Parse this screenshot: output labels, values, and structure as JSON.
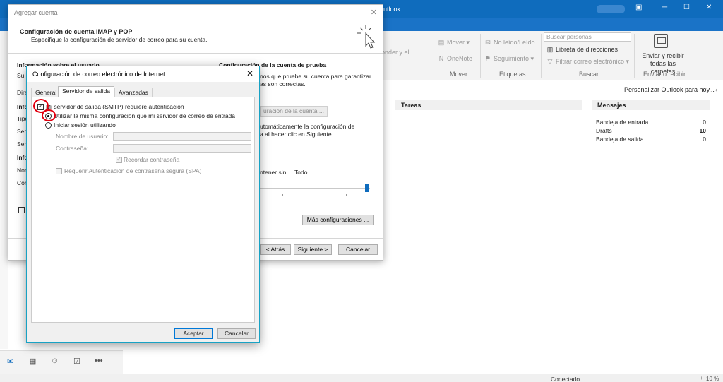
{
  "outlook": {
    "app_title": "utlook",
    "ribbon": {
      "mover": "Mover",
      "onenote": "OneNote",
      "group_mover": "Mover",
      "no_leido": "No leído/Leído",
      "seguimiento": "Seguimiento",
      "group_etiquetas": "Etiquetas",
      "search_placeholder": "Buscar personas",
      "libreta": "Libreta de direcciones",
      "filtrar": "Filtrar correo electrónico",
      "group_buscar": "Buscar",
      "enviar_recibir": "Enviar y recibir todas las carpetas",
      "group_enviar": "Enviar o recibir",
      "partial_text": "onder y eli..."
    },
    "personalize": "Personalizar Outlook para hoy...",
    "tareas_header": "Tareas",
    "mensajes_header": "Mensajes",
    "mensajes": [
      {
        "name": "Bandeja de entrada",
        "count": "0"
      },
      {
        "name": "Drafts",
        "count": "10"
      },
      {
        "name": "Bandeja de salida",
        "count": "0"
      }
    ],
    "status": "Conectado",
    "zoom": "10 %",
    "nav_icons": [
      "mail-icon",
      "calendar-icon",
      "people-icon",
      "tasks-icon",
      "more-icon"
    ]
  },
  "agregar_cuenta": {
    "window_title": "Agregar cuenta",
    "heading": "Configuración de cuenta IMAP y POP",
    "subheading": "Especifique la configuración de servidor de correo para su cuenta.",
    "user_info_header": "Información sobre el usuario",
    "left_partial": [
      "Su",
      "Dire",
      "Info",
      "Tipo",
      "Ser",
      "Ser",
      "Info",
      "Nor",
      "Con"
    ],
    "test_header": "Configuración de la cuenta de prueba",
    "test_text_1": "nos que pruebe su cuenta para garantizar",
    "test_text_2": "as son correctas.",
    "test_button": "uración de la cuenta ...",
    "auto_text_1": "utomáticamente la configuración de",
    "auto_text_2": "a al hacer clic en Siguiente",
    "mantener": "ntener sin",
    "todo": "Todo",
    "mas_config": "Más configuraciones ...",
    "atras": "< Atrás",
    "siguiente": "Siguiente >",
    "cancelar": "Cancelar"
  },
  "internet_dialog": {
    "title": "Configuración de correo electrónico de Internet",
    "tabs": [
      "General",
      "Servidor de salida",
      "Avanzadas"
    ],
    "smtp_auth": "Mi servidor de salida (SMTP) requiere autenticación",
    "smtp_auth_checked": true,
    "use_same": "Utilizar la misma configuración que mi servidor de correo de entrada",
    "use_same_selected": true,
    "login_using": "Iniciar sesión utilizando",
    "username_label": "Nombre de usuario:",
    "username_value": "",
    "password_label": "Contraseña:",
    "password_value": "",
    "remember_password": "Recordar contraseña",
    "spa": "Requerir Autenticación de contraseña segura (SPA)",
    "aceptar": "Aceptar",
    "cancelar": "Cancelar",
    "annotation_color": "#e2000f"
  }
}
